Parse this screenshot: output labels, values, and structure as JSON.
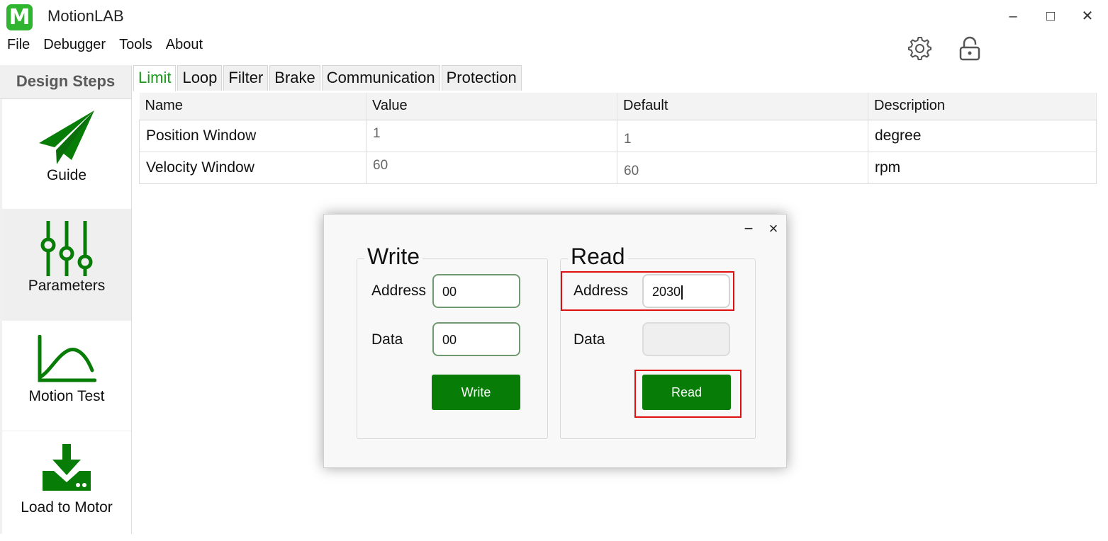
{
  "app": {
    "logo_letter": "M",
    "title": "MotionLAB",
    "brand_color": "#2fb52f",
    "accent_green": "#077d07"
  },
  "window_controls": {
    "minimize": "‒",
    "maximize": "□",
    "close": "✕"
  },
  "menu": [
    "File",
    "Debugger",
    "Tools",
    "About"
  ],
  "toolbar_icons": [
    "gear-icon",
    "lock-icon"
  ],
  "sidebar": {
    "title": "Design Steps",
    "steps": [
      {
        "label": "Guide",
        "icon": "paper-plane-icon",
        "active": false
      },
      {
        "label": "Parameters",
        "icon": "sliders-icon",
        "active": true
      },
      {
        "label": "Motion Test",
        "icon": "curve-chart-icon",
        "active": false
      },
      {
        "label": "Load to Motor",
        "icon": "download-icon",
        "active": false
      }
    ]
  },
  "tabs": [
    "Limit",
    "Loop",
    "Filter",
    "Brake",
    "Communication",
    "Protection"
  ],
  "active_tab": "Limit",
  "table": {
    "columns": [
      "Name",
      "Value",
      "Default",
      "Description"
    ],
    "rows": [
      {
        "name": "Position Window",
        "value": "1",
        "default": "1",
        "description": "degree"
      },
      {
        "name": "Velocity Window",
        "value": "60",
        "default": "60",
        "description": "rpm"
      }
    ]
  },
  "dialog": {
    "minimize": "−",
    "close": "×",
    "write": {
      "title": "Write",
      "address_label": "Address",
      "address_value": "00",
      "data_label": "Data",
      "data_value": "00",
      "button": "Write"
    },
    "read": {
      "title": "Read",
      "address_label": "Address",
      "address_value": "2030",
      "data_label": "Data",
      "data_value": "",
      "button": "Read"
    },
    "highlight_color": "#e01010"
  }
}
